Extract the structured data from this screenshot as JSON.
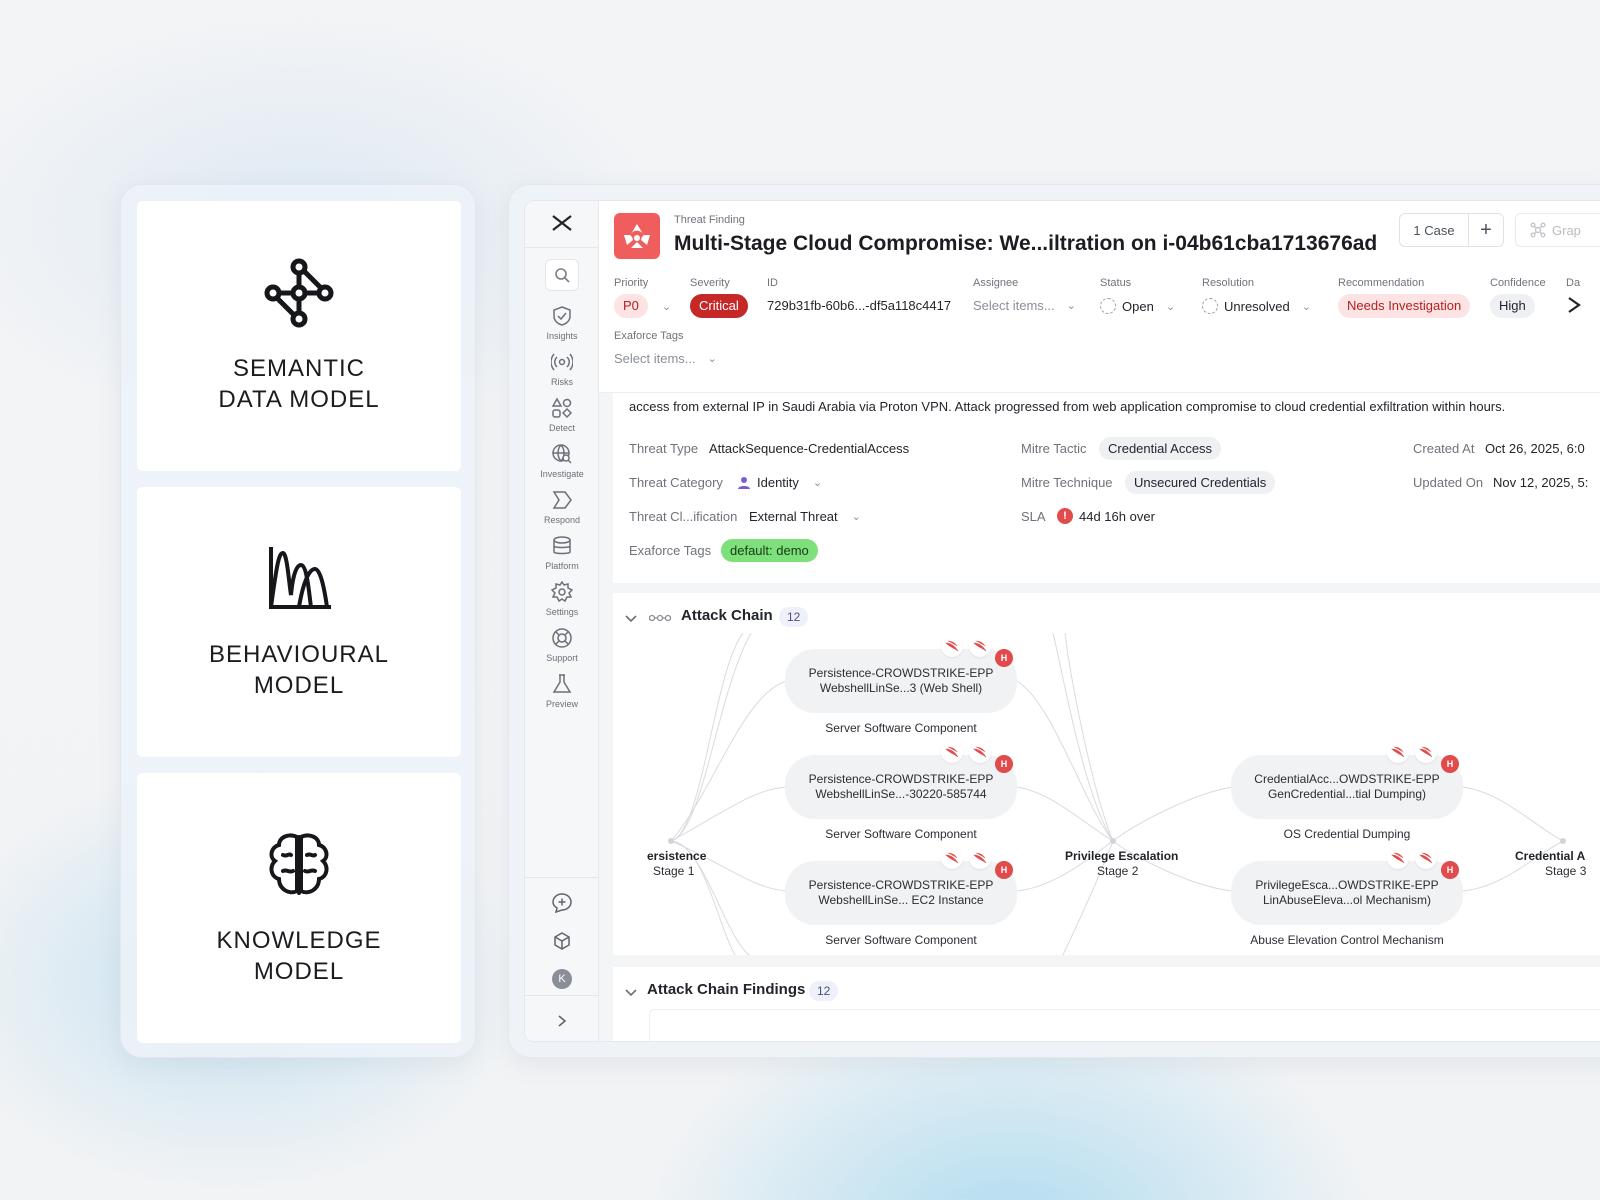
{
  "models": [
    {
      "title": "SEMANTIC\nDATA MODEL",
      "icon": "network-graph-icon"
    },
    {
      "title": "BEHAVIOURAL\nMODEL",
      "icon": "behavior-chart-icon"
    },
    {
      "title": "KNOWLEDGE\nMODEL",
      "icon": "brain-icon"
    }
  ],
  "sidebar": {
    "items": [
      {
        "label": "Insights",
        "icon": "shield-check-icon"
      },
      {
        "label": "Risks",
        "icon": "broadcast-icon"
      },
      {
        "label": "Detect",
        "icon": "shapes-icon"
      },
      {
        "label": "Investigate",
        "icon": "globe-search-icon"
      },
      {
        "label": "Respond",
        "icon": "chevron-arrow-icon"
      },
      {
        "label": "Platform",
        "icon": "database-icon"
      },
      {
        "label": "Settings",
        "icon": "gear-icon"
      },
      {
        "label": "Support",
        "icon": "lifebuoy-icon"
      },
      {
        "label": "Preview",
        "icon": "flask-icon"
      }
    ],
    "avatar_initial": "K"
  },
  "header": {
    "kicker": "Threat Finding",
    "title": "Multi-Stage Cloud Compromise: We...iltration on i-04b61cba1713676ad",
    "case_label": "1 Case",
    "plus_label": "+",
    "graph_label": "Grap",
    "fields": {
      "priority_label": "Priority",
      "priority_value": "P0",
      "severity_label": "Severity",
      "severity_value": "Critical",
      "id_label": "ID",
      "id_value": "729b31fb-60b6...-df5a118c4417",
      "assignee_label": "Assignee",
      "assignee_placeholder": "Select items...",
      "status_label": "Status",
      "status_value": "Open",
      "resolution_label": "Resolution",
      "resolution_value": "Unresolved",
      "recommendation_label": "Recommendation",
      "recommendation_value": "Needs Investigation",
      "confidence_label": "Confidence",
      "confidence_value": "High",
      "da_label": "Da",
      "tags_label": "Exaforce Tags",
      "tags_placeholder": "Select items..."
    }
  },
  "details": {
    "description": "access from external IP in Saudi Arabia via Proton VPN. Attack progressed from web application compromise to cloud credential exfiltration within hours.",
    "threat_type_label": "Threat Type",
    "threat_type_value": "AttackSequence-CredentialAccess",
    "threat_category_label": "Threat Category",
    "threat_category_value": "Identity",
    "threat_class_label": "Threat Cl...ification",
    "threat_class_value": "External Threat",
    "tags_label": "Exaforce Tags",
    "tags_value": "default: demo",
    "mitre_tactic_label": "Mitre Tactic",
    "mitre_tactic_value": "Credential Access",
    "mitre_technique_label": "Mitre Technique",
    "mitre_technique_value": "Unsecured Credentials",
    "sla_label": "SLA",
    "sla_value": "44d 16h over",
    "created_label": "Created At",
    "created_value": "Oct 26, 2025, 6:0",
    "updated_label": "Updated On",
    "updated_value": "Nov 12, 2025, 5:"
  },
  "attack_chain": {
    "title": "Attack Chain",
    "count": "12",
    "stages": [
      {
        "name": "ersistence",
        "sub": "Stage 1"
      },
      {
        "name": "Privilege Escalation",
        "sub": "Stage 2"
      },
      {
        "name": "Credential A",
        "sub": "Stage 3"
      }
    ],
    "nodes": [
      {
        "line1": "Persistence-CROWDSTRIKE-EPP",
        "line2": "WebshellLinSe...3 (Web Shell)",
        "caption": "Server Software Component",
        "badge": "H"
      },
      {
        "line1": "Persistence-CROWDSTRIKE-EPP",
        "line2": "WebshellLinSe...-30220-585744",
        "caption": "Server Software Component",
        "badge": "H"
      },
      {
        "line1": "Persistence-CROWDSTRIKE-EPP",
        "line2": "WebshellLinSe... EC2 Instance",
        "caption": "Server Software Component",
        "badge": "H"
      },
      {
        "line1": "CredentialAcc...OWDSTRIKE-EPP",
        "line2": "GenCredential...tial Dumping)",
        "caption": "OS Credential Dumping",
        "badge": "H"
      },
      {
        "line1": "PrivilegeEsca...OWDSTRIKE-EPP",
        "line2": "LinAbuseEleva...ol Mechanism)",
        "caption": "Abuse Elevation Control Mechanism",
        "badge": "H"
      }
    ]
  },
  "findings": {
    "title": "Attack Chain Findings",
    "count": "12"
  },
  "colors": {
    "critical": "#c62828",
    "p0_bg": "#fde3e3",
    "recommendation_bg": "#fde3e3",
    "tag_green": "#7ee07a",
    "threat_red": "#ef5d5d"
  }
}
